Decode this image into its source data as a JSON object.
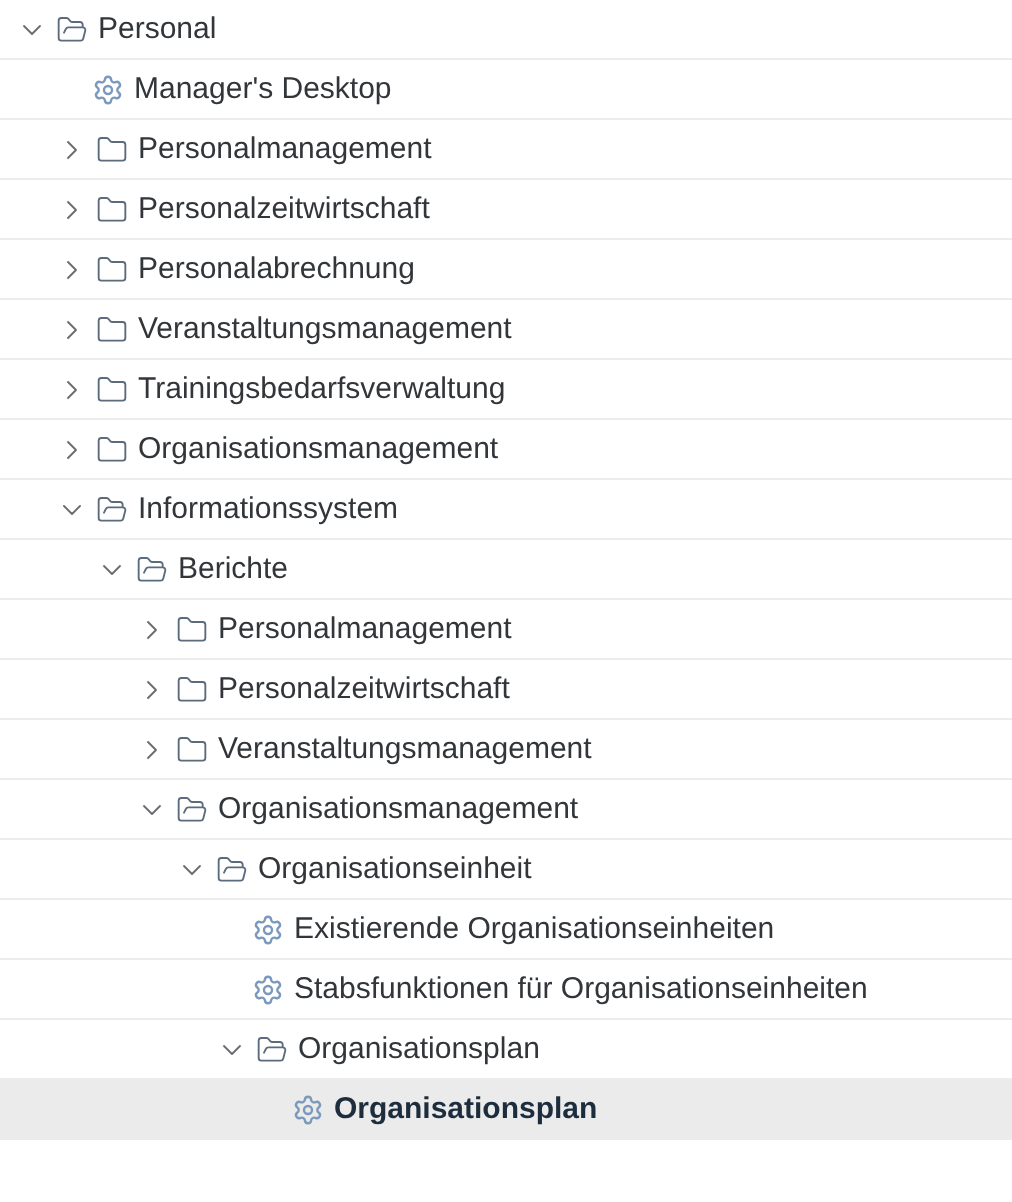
{
  "tree": [
    {
      "label": "Personal",
      "kind": "folder",
      "expanded": true,
      "selected": false,
      "children": [
        {
          "label": "Manager's Desktop",
          "kind": "transaction",
          "selected": false
        },
        {
          "label": "Personalmanagement",
          "kind": "folder",
          "expanded": false,
          "selected": false
        },
        {
          "label": "Personalzeitwirtschaft",
          "kind": "folder",
          "expanded": false,
          "selected": false
        },
        {
          "label": "Personalabrechnung",
          "kind": "folder",
          "expanded": false,
          "selected": false
        },
        {
          "label": "Veranstaltungsmanagement",
          "kind": "folder",
          "expanded": false,
          "selected": false
        },
        {
          "label": "Trainingsbedarfsverwaltung",
          "kind": "folder",
          "expanded": false,
          "selected": false
        },
        {
          "label": "Organisationsmanagement",
          "kind": "folder",
          "expanded": false,
          "selected": false
        },
        {
          "label": "Informationssystem",
          "kind": "folder",
          "expanded": true,
          "selected": false,
          "children": [
            {
              "label": "Berichte",
              "kind": "folder",
              "expanded": true,
              "selected": false,
              "children": [
                {
                  "label": "Personalmanagement",
                  "kind": "folder",
                  "expanded": false,
                  "selected": false
                },
                {
                  "label": "Personalzeitwirtschaft",
                  "kind": "folder",
                  "expanded": false,
                  "selected": false
                },
                {
                  "label": "Veranstaltungsmanagement",
                  "kind": "folder",
                  "expanded": false,
                  "selected": false
                },
                {
                  "label": "Organisationsmanagement",
                  "kind": "folder",
                  "expanded": true,
                  "selected": false,
                  "children": [
                    {
                      "label": "Organisationseinheit",
                      "kind": "folder",
                      "expanded": true,
                      "selected": false,
                      "children": [
                        {
                          "label": "Existierende Organisationseinheiten",
                          "kind": "transaction",
                          "selected": false
                        },
                        {
                          "label": "Stabsfunktionen für Organisationseinheiten",
                          "kind": "transaction",
                          "selected": false
                        },
                        {
                          "label": "Organisationsplan",
                          "kind": "folder",
                          "expanded": true,
                          "selected": false,
                          "children": [
                            {
                              "label": "Organisationsplan",
                              "kind": "transaction",
                              "selected": true
                            }
                          ]
                        }
                      ]
                    }
                  ]
                }
              ]
            }
          ]
        }
      ]
    }
  ]
}
